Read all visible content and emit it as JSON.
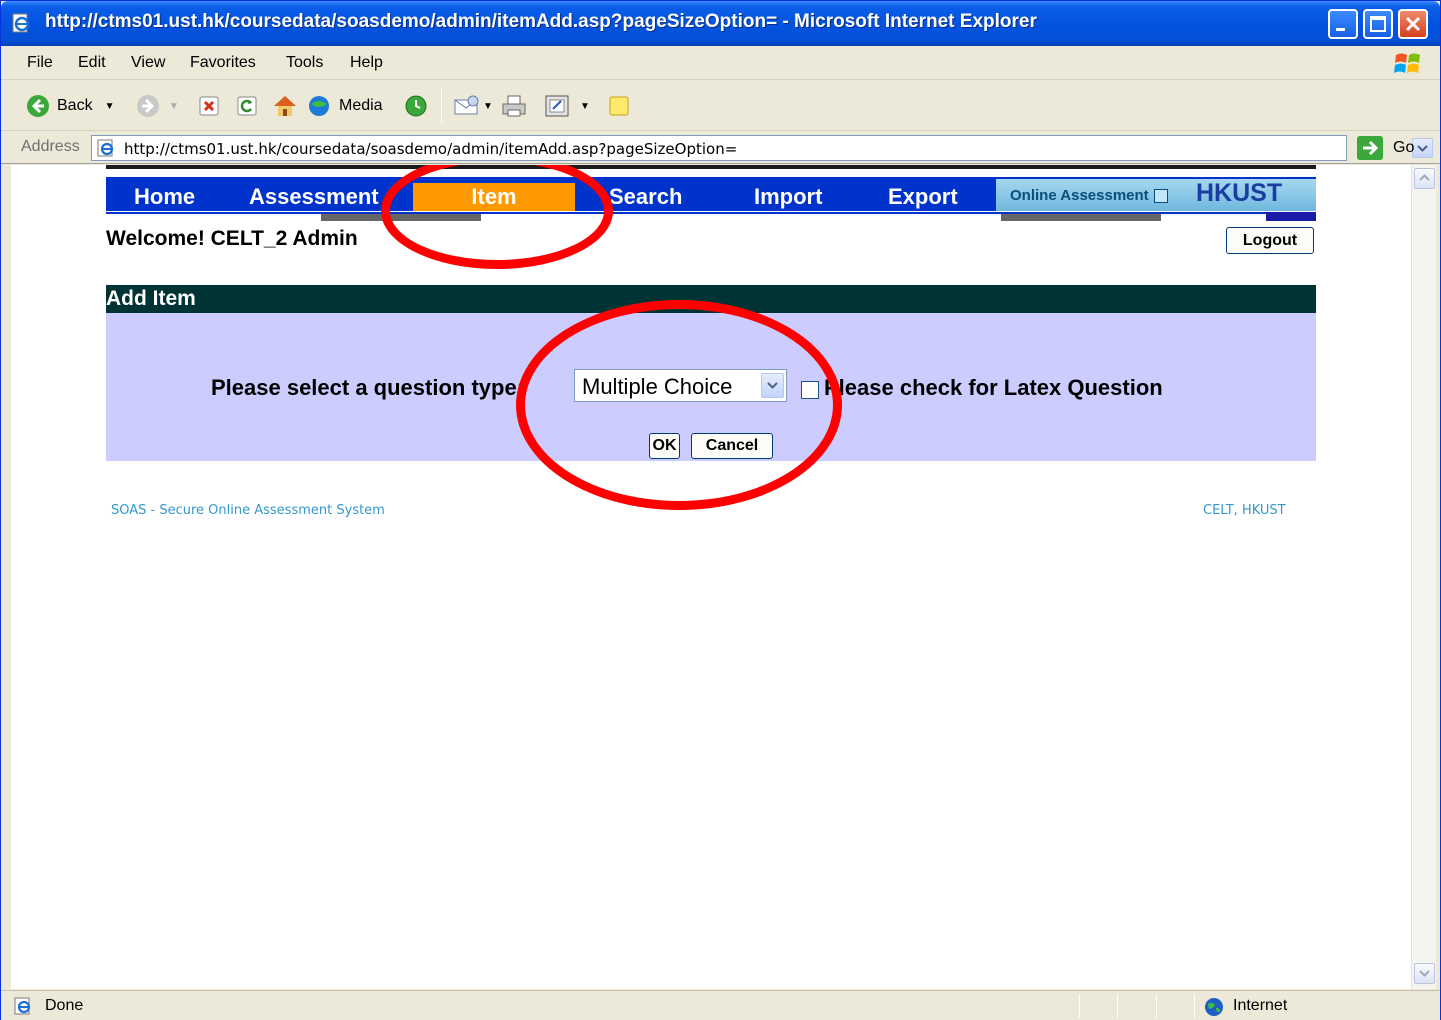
{
  "window": {
    "title": "http://ctms01.ust.hk/coursedata/soasdemo/admin/itemAdd.asp?pageSizeOption= - Microsoft Internet Explorer"
  },
  "menu": {
    "items": [
      {
        "label": "File"
      },
      {
        "label": "Edit"
      },
      {
        "label": "View"
      },
      {
        "label": "Favorites"
      },
      {
        "label": "Tools"
      },
      {
        "label": "Help"
      }
    ]
  },
  "toolbar": {
    "back_label": "Back",
    "media_label": "Media"
  },
  "address": {
    "label": "Address",
    "url": "http://ctms01.ust.hk/coursedata/soasdemo/admin/itemAdd.asp?pageSizeOption=",
    "go_label": "Go"
  },
  "site_nav": {
    "items": [
      {
        "label": "Home"
      },
      {
        "label": "Assessment"
      },
      {
        "label": "Item"
      },
      {
        "label": "Search"
      },
      {
        "label": "Import"
      },
      {
        "label": "Export"
      }
    ],
    "active": "Item",
    "brand_subtitle": "Online Assessment",
    "brand_name": "HKUST",
    "active_color": "#ff9900",
    "bar_color": "#0033cc"
  },
  "user": {
    "welcome": "Welcome! CELT_2 Admin",
    "logout_label": "Logout"
  },
  "add_item": {
    "header": "Add Item",
    "question_type_label": "Please select a question type:",
    "question_type_value": "Multiple Choice",
    "latex_label": "Please check for Latex Question",
    "latex_checked": false,
    "ok_label": "OK",
    "cancel_label": "Cancel",
    "header_color": "#003333",
    "panel_color": "#ccccff"
  },
  "footer": {
    "left": "SOAS - Secure Online Assessment System",
    "right": "CELT, HKUST"
  },
  "status": {
    "text": "Done",
    "zone": "Internet"
  },
  "annotation_color": "#ff0000"
}
